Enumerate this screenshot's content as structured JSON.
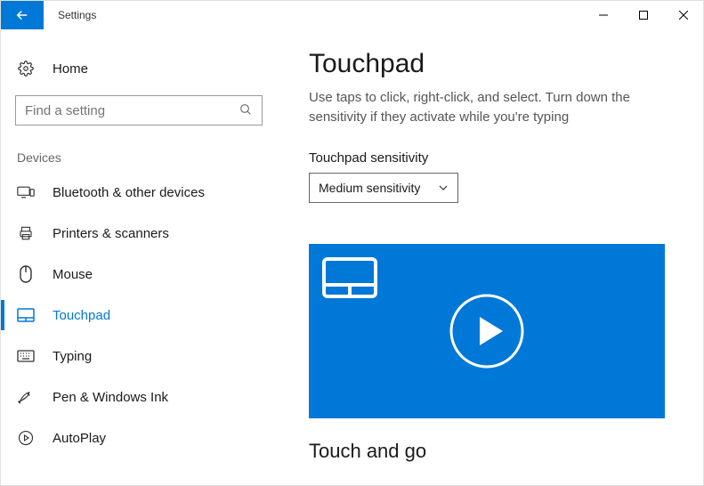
{
  "window": {
    "title": "Settings"
  },
  "sidebar": {
    "home_label": "Home",
    "search_placeholder": "Find a setting",
    "group_label": "Devices",
    "items": [
      {
        "label": "Bluetooth & other devices"
      },
      {
        "label": "Printers & scanners"
      },
      {
        "label": "Mouse"
      },
      {
        "label": "Touchpad"
      },
      {
        "label": "Typing"
      },
      {
        "label": "Pen & Windows Ink"
      },
      {
        "label": "AutoPlay"
      }
    ]
  },
  "main": {
    "title": "Touchpad",
    "description": "Use taps to click, right-click, and select. Turn down the sensitivity if they activate while you're typing",
    "sensitivity_label": "Touchpad sensitivity",
    "sensitivity_value": "Medium sensitivity",
    "subheading": "Touch and go"
  }
}
